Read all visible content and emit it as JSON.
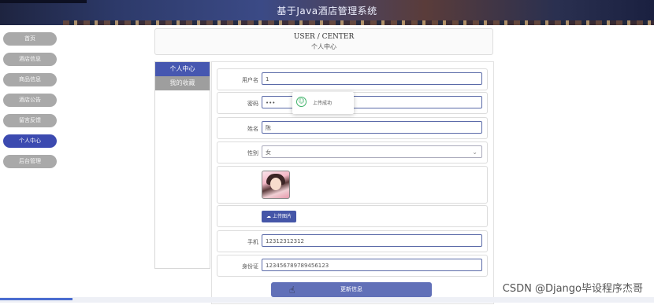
{
  "header": {
    "title": "基于Java酒店管理系统"
  },
  "nav": {
    "items": [
      {
        "label": "首页"
      },
      {
        "label": "酒店信息"
      },
      {
        "label": "商品信息"
      },
      {
        "label": "酒店公告"
      },
      {
        "label": "留言反馈"
      },
      {
        "label": "个人中心"
      },
      {
        "label": "后台管理"
      }
    ],
    "active_index": 5
  },
  "center_header": {
    "en": "USER / CENTER",
    "cn": "个人中心"
  },
  "tabs": [
    {
      "label": "个人中心"
    },
    {
      "label": "我的收藏"
    }
  ],
  "form": {
    "username": {
      "label": "用户名",
      "value": "1"
    },
    "password": {
      "label": "密码",
      "value": "•••"
    },
    "name": {
      "label": "姓名",
      "value": "陈"
    },
    "gender": {
      "label": "性别",
      "value": "女"
    },
    "upload_label": "上传图片",
    "phone": {
      "label": "手机",
      "value": "12312312312"
    },
    "idcard": {
      "label": "身份证",
      "value": "123456789789456123"
    },
    "save_label": "更新信息"
  },
  "toast": {
    "message": "上传成功"
  },
  "watermark": "CSDN @Django毕设程序杰哥",
  "colors": {
    "accent": "#4657b0",
    "nav_inactive": "#a9a9a9",
    "success": "#41b36a"
  }
}
